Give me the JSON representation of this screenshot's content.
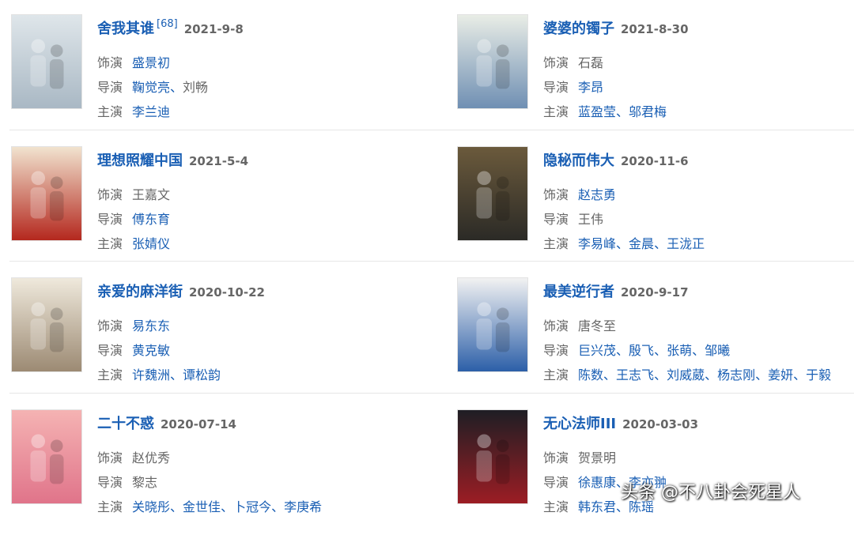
{
  "labels": {
    "role": "饰演",
    "director": "导演",
    "star": "主演"
  },
  "entries": [
    {
      "title": "舍我其谁",
      "citation": "[68]",
      "date": "2021-9-8",
      "role": {
        "text": "盛景初",
        "linked": true
      },
      "directors": [
        {
          "text": "鞠觉亮",
          "linked": true
        },
        {
          "text": "刘畅",
          "linked": false
        }
      ],
      "stars": [
        {
          "text": "李兰迪",
          "linked": true
        }
      ],
      "poster_colors": [
        "#dfe6ea",
        "#a9b8c4"
      ]
    },
    {
      "title": "婆婆的镯子",
      "citation": "",
      "date": "2021-8-30",
      "role": {
        "text": "石磊",
        "linked": false
      },
      "directors": [
        {
          "text": "李昂",
          "linked": true
        }
      ],
      "stars": [
        {
          "text": "蓝盈莹",
          "linked": true
        },
        {
          "text": "邬君梅",
          "linked": true
        }
      ],
      "poster_colors": [
        "#e9ede6",
        "#6f8fb3"
      ]
    },
    {
      "title": "理想照耀中国",
      "citation": "",
      "date": "2021-5-4",
      "role": {
        "text": "王嘉文",
        "linked": false
      },
      "directors": [
        {
          "text": "傅东育",
          "linked": true
        }
      ],
      "stars": [
        {
          "text": "张婧仪",
          "linked": true
        }
      ],
      "poster_colors": [
        "#f1e3cf",
        "#b4281e"
      ]
    },
    {
      "title": "隐秘而伟大",
      "citation": "",
      "date": "2020-11-6",
      "role": {
        "text": "赵志勇",
        "linked": true
      },
      "directors": [
        {
          "text": "王伟",
          "linked": false
        }
      ],
      "stars": [
        {
          "text": "李易峰",
          "linked": true
        },
        {
          "text": "金晨",
          "linked": true
        },
        {
          "text": "王泷正",
          "linked": true
        }
      ],
      "poster_colors": [
        "#6b5a3c",
        "#2b2a26"
      ]
    },
    {
      "title": "亲爱的麻洋街",
      "citation": "",
      "date": "2020-10-22",
      "role": {
        "text": "易东东",
        "linked": true
      },
      "directors": [
        {
          "text": "黄克敏",
          "linked": true
        }
      ],
      "stars": [
        {
          "text": "许魏洲",
          "linked": true
        },
        {
          "text": "谭松韵",
          "linked": true
        }
      ],
      "poster_colors": [
        "#efe9dc",
        "#9c8a73"
      ]
    },
    {
      "title": "最美逆行者",
      "citation": "",
      "date": "2020-9-17",
      "role": {
        "text": "唐冬至",
        "linked": false
      },
      "directors": [
        {
          "text": "巨兴茂",
          "linked": true
        },
        {
          "text": "殷飞",
          "linked": true
        },
        {
          "text": "张萌",
          "linked": true
        },
        {
          "text": "邹曦",
          "linked": true
        }
      ],
      "stars": [
        {
          "text": "陈数",
          "linked": true
        },
        {
          "text": "王志飞",
          "linked": true
        },
        {
          "text": "刘威葳",
          "linked": true
        },
        {
          "text": "杨志刚",
          "linked": true
        },
        {
          "text": "姜妍",
          "linked": true
        },
        {
          "text": "于毅",
          "linked": true
        }
      ],
      "poster_colors": [
        "#f2f2f2",
        "#2c5fa8"
      ]
    },
    {
      "title": "二十不惑",
      "citation": "",
      "date": "2020-07-14",
      "role": {
        "text": "赵优秀",
        "linked": false
      },
      "directors": [
        {
          "text": "黎志",
          "linked": false
        }
      ],
      "stars": [
        {
          "text": "关晓彤",
          "linked": true
        },
        {
          "text": "金世佳",
          "linked": true
        },
        {
          "text": "卜冠今",
          "linked": true
        },
        {
          "text": "李庚希",
          "linked": true
        }
      ],
      "poster_colors": [
        "#f5b3b3",
        "#e0748a"
      ]
    },
    {
      "title": "无心法师III",
      "citation": "",
      "date": "2020-03-03",
      "role": {
        "text": "贺景明",
        "linked": false
      },
      "directors": [
        {
          "text": "徐惠康",
          "linked": true
        },
        {
          "text": "李亦翀",
          "linked": true
        }
      ],
      "stars": [
        {
          "text": "韩东君",
          "linked": true
        },
        {
          "text": "陈瑶",
          "linked": true
        }
      ],
      "poster_colors": [
        "#1e1e24",
        "#9c1d24"
      ]
    }
  ],
  "watermark": "头条 @不八卦会死星人"
}
